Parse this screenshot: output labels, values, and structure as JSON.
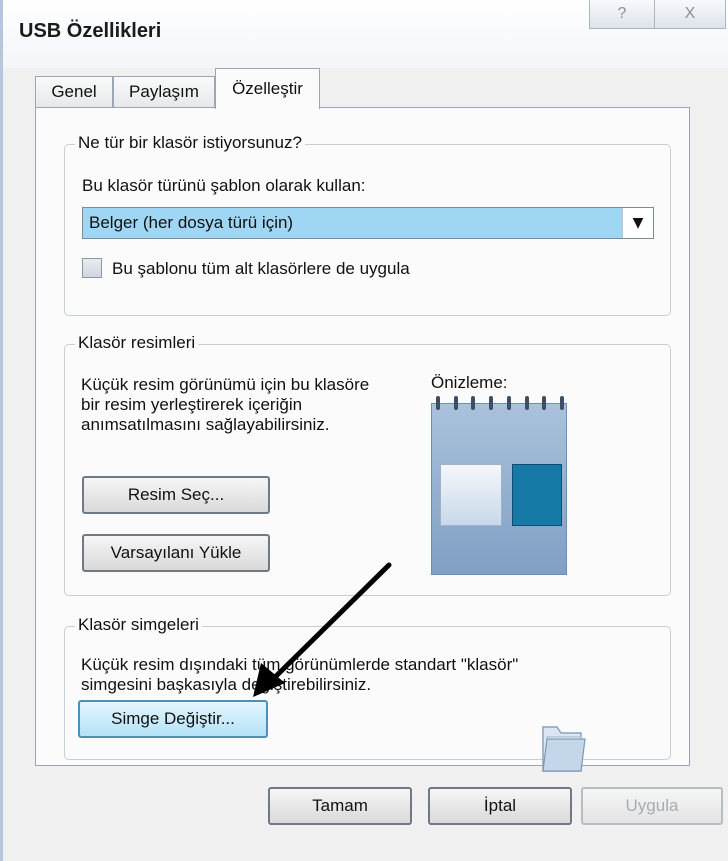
{
  "window": {
    "title": "USB Özellikleri",
    "help_glyph": "?",
    "close_glyph": "X"
  },
  "tabs": [
    {
      "label": "Genel"
    },
    {
      "label": "Paylaşım"
    },
    {
      "label": "Özelleştir",
      "active": true
    }
  ],
  "folder_type_group": {
    "title": "Ne tür bir klasör istiyorsunuz?",
    "template_label": "Bu klasör türünü şablon olarak kullan:",
    "selected_value": "Belger (her dosya türü için)",
    "apply_checkbox_label": "Bu şablonu tüm alt klasörlere de uygula",
    "apply_checkbox_checked": false
  },
  "folder_pictures_group": {
    "title": "Klasör resimleri",
    "description_lines": [
      "Küçük resim görünümü için bu klasöre",
      "bir resim yerleştirerek içeriğin",
      "anımsatılmasını sağlayabilirsiniz."
    ],
    "preview_label": "Önizleme:",
    "choose_button": "Resim Seç...",
    "restore_button": "Varsayılanı Yükle"
  },
  "folder_icons_group": {
    "title": "Klasör simgeleri",
    "description_lines": [
      "Küçük resim dışındaki tüm görünümlerde standart \"klasör\"",
      "simgesini başkasıyla değiştirebilirsiniz."
    ],
    "change_icon_button": "Simge Değiştir..."
  },
  "footer": {
    "ok_button": "Tamam",
    "cancel_button": "İptal",
    "apply_button": "Uygula"
  },
  "icons": {
    "dropdown": "chevron-down-icon",
    "preview": "calendar-preview-icon",
    "folder": "folder-icon",
    "annotation": "arrow-annotation-icon"
  },
  "colors": {
    "selection_blue": "#9fd6f3",
    "focus_button": "#b4e2f7"
  }
}
